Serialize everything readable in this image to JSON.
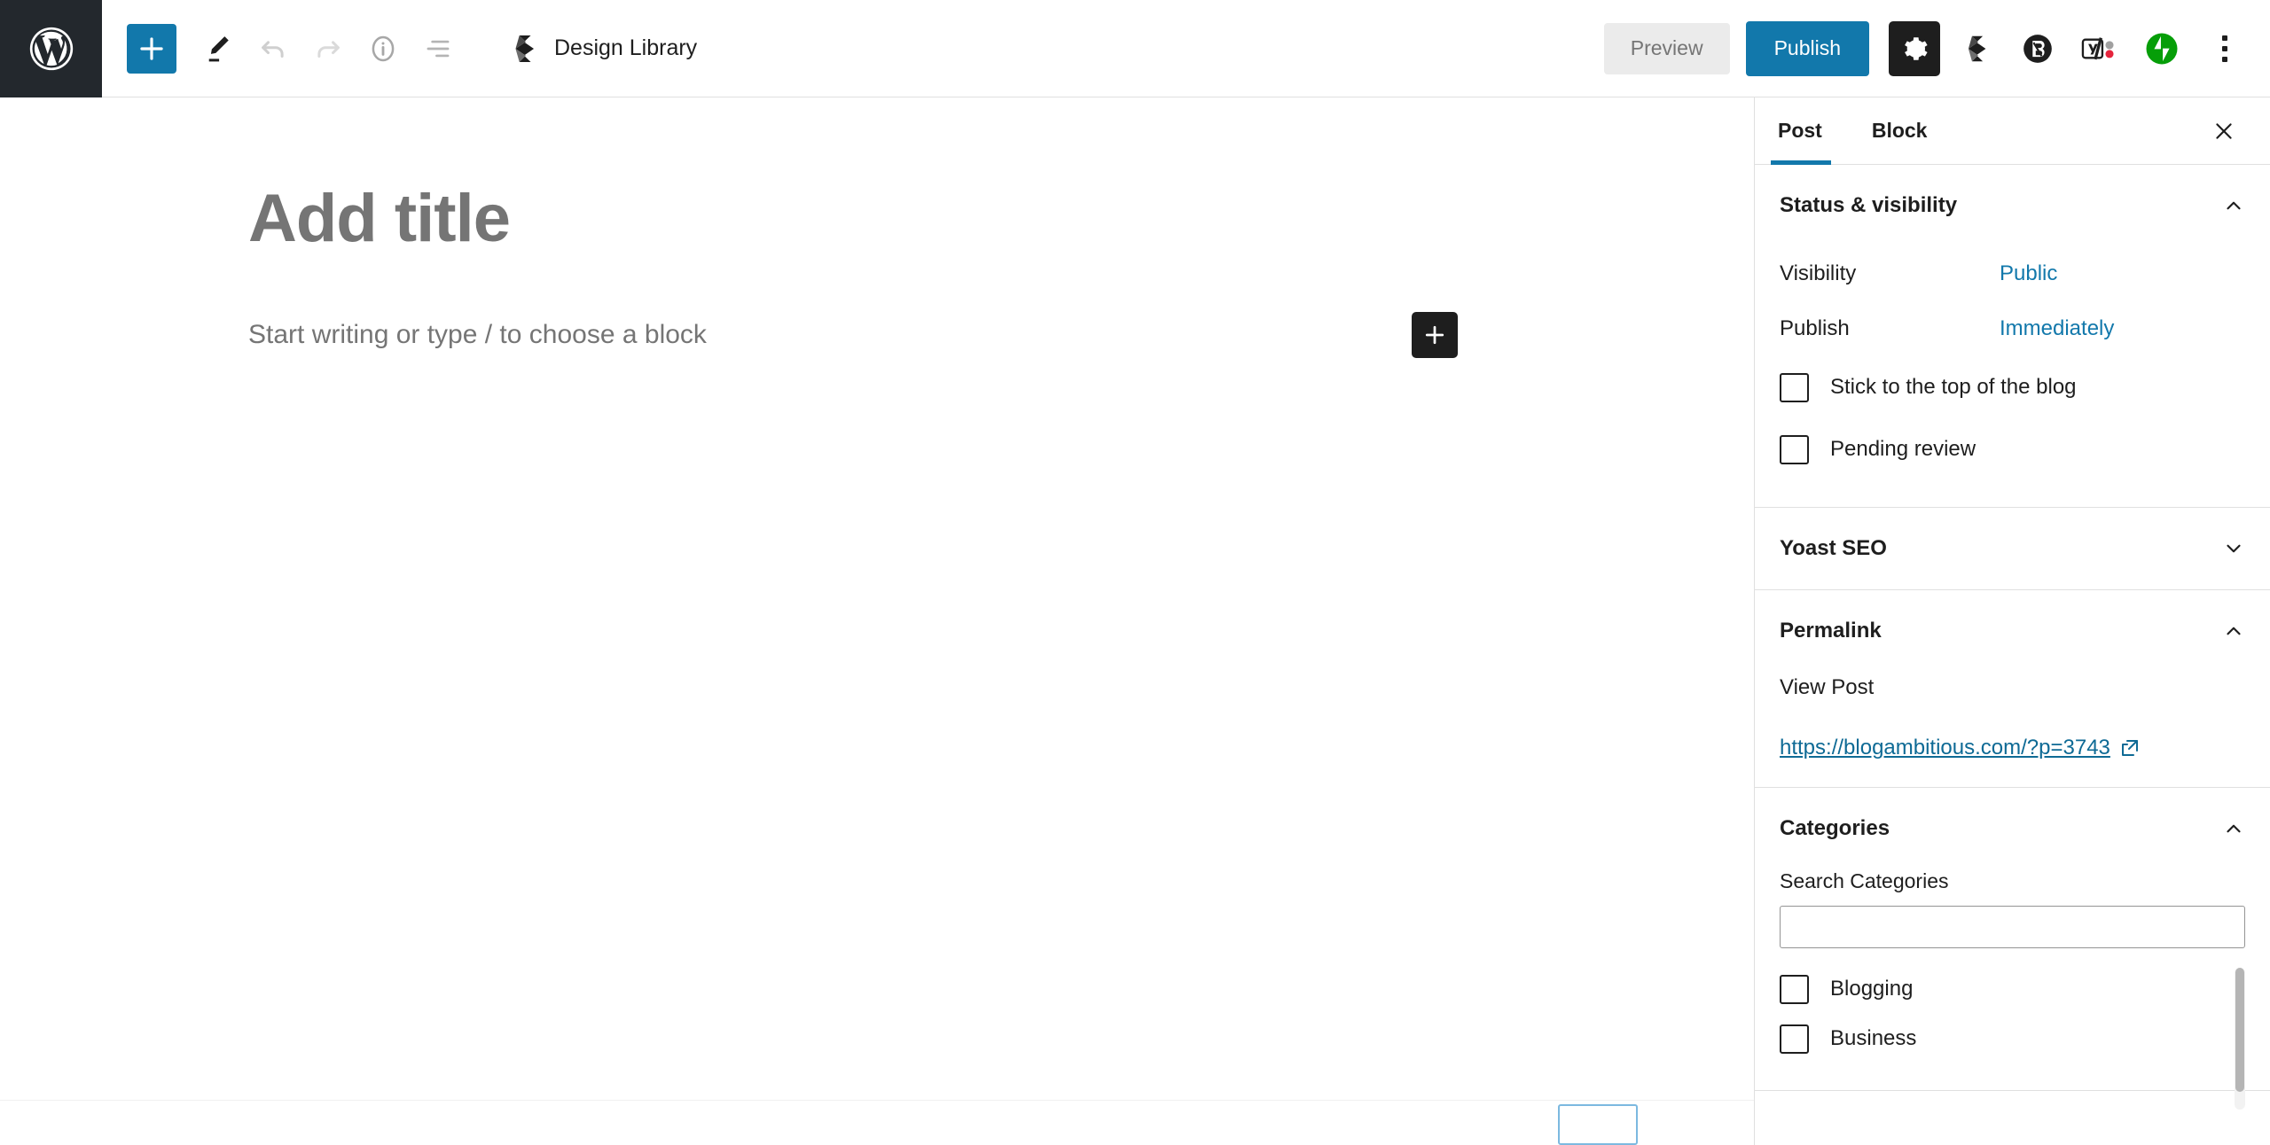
{
  "toolbar": {
    "wp_logo_label": "W",
    "inserter_label": "Toggle block inserter",
    "tools_label": "Tools",
    "undo_label": "Undo",
    "redo_label": "Redo",
    "details_label": "Details",
    "list_view_label": "List View",
    "document_title": "Design Library",
    "preview_label": "Preview",
    "publish_label": "Publish",
    "settings_label": "Settings",
    "plugin_design_library_label": "Design Library",
    "plugin_blocksy_label": "Blocksy",
    "plugin_yoast_label": "Yoast SEO",
    "plugin_jetpack_label": "Jetpack",
    "options_label": "Options"
  },
  "editor": {
    "title_placeholder": "Add title",
    "paragraph_placeholder": "Start writing or type / to choose a block",
    "add_block_label": "Add block"
  },
  "sidebar": {
    "tabs": [
      {
        "label": "Post",
        "active": true
      },
      {
        "label": "Block",
        "active": false
      }
    ],
    "close_label": "Close settings",
    "panels": [
      {
        "title": "Status & visibility",
        "expanded": true,
        "rows": [
          {
            "label": "Visibility",
            "value": "Public"
          },
          {
            "label": "Publish",
            "value": "Immediately"
          }
        ],
        "checkboxes": [
          {
            "label": "Stick to the top of the blog",
            "checked": false
          },
          {
            "label": "Pending review",
            "checked": false
          }
        ]
      },
      {
        "title": "Yoast SEO",
        "expanded": false
      },
      {
        "title": "Permalink",
        "expanded": true,
        "view_post_label": "View Post",
        "url": "https://blogambitious.com/?p=3743"
      },
      {
        "title": "Categories",
        "expanded": true,
        "search_label": "Search Categories",
        "search_value": "",
        "items": [
          {
            "label": "Blogging",
            "checked": false
          },
          {
            "label": "Business",
            "checked": false
          }
        ]
      }
    ]
  },
  "colors": {
    "accent": "#1278ab",
    "admin_bar": "#23282d",
    "link": "#0e6a95",
    "muted_text": "#757575",
    "border": "#e0e0e0",
    "dark": "#1e1e1e",
    "jetpack_green": "#069e08",
    "yoast_red": "#e5243c"
  }
}
